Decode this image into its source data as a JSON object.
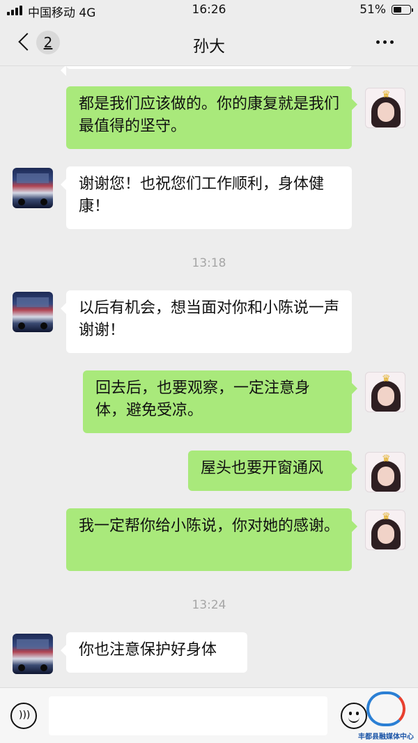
{
  "status_bar": {
    "carrier": "中国移动 4G",
    "time": "16:26",
    "battery_percent": "51%",
    "battery_level": 0.51
  },
  "header": {
    "unread_count": "2",
    "title": "孙大"
  },
  "messages": [
    {
      "side": "right",
      "text": "都是我们应该做的。你的康复就是我们最值得的坚守。"
    },
    {
      "side": "left",
      "text": "谢谢您！也祝您们工作顺利，身体健康！"
    },
    {
      "type": "time",
      "text": "13:18"
    },
    {
      "side": "left",
      "text": "以后有机会，想当面对你和小陈说一声谢谢！"
    },
    {
      "side": "right",
      "text": "回去后，也要观察，一定注意身体，避免受凉。"
    },
    {
      "side": "right",
      "text": "屋头也要开窗通风"
    },
    {
      "side": "right",
      "text": "我一定帮你给小陈说，你对她的感谢。"
    },
    {
      "type": "time",
      "text": "13:24"
    },
    {
      "side": "left",
      "text": "你也注意保护好身体"
    }
  ],
  "input": {
    "value": "",
    "placeholder": ""
  },
  "watermark": {
    "text": "丰都县融媒体中心"
  },
  "icons": {
    "back": "chevron-left-icon",
    "more": "more-dots-icon",
    "voice": "voice-icon",
    "emoji": "emoji-icon"
  },
  "colors": {
    "sent_bubble": "#a9e97b",
    "received_bubble": "#ffffff",
    "background": "#ededed"
  }
}
